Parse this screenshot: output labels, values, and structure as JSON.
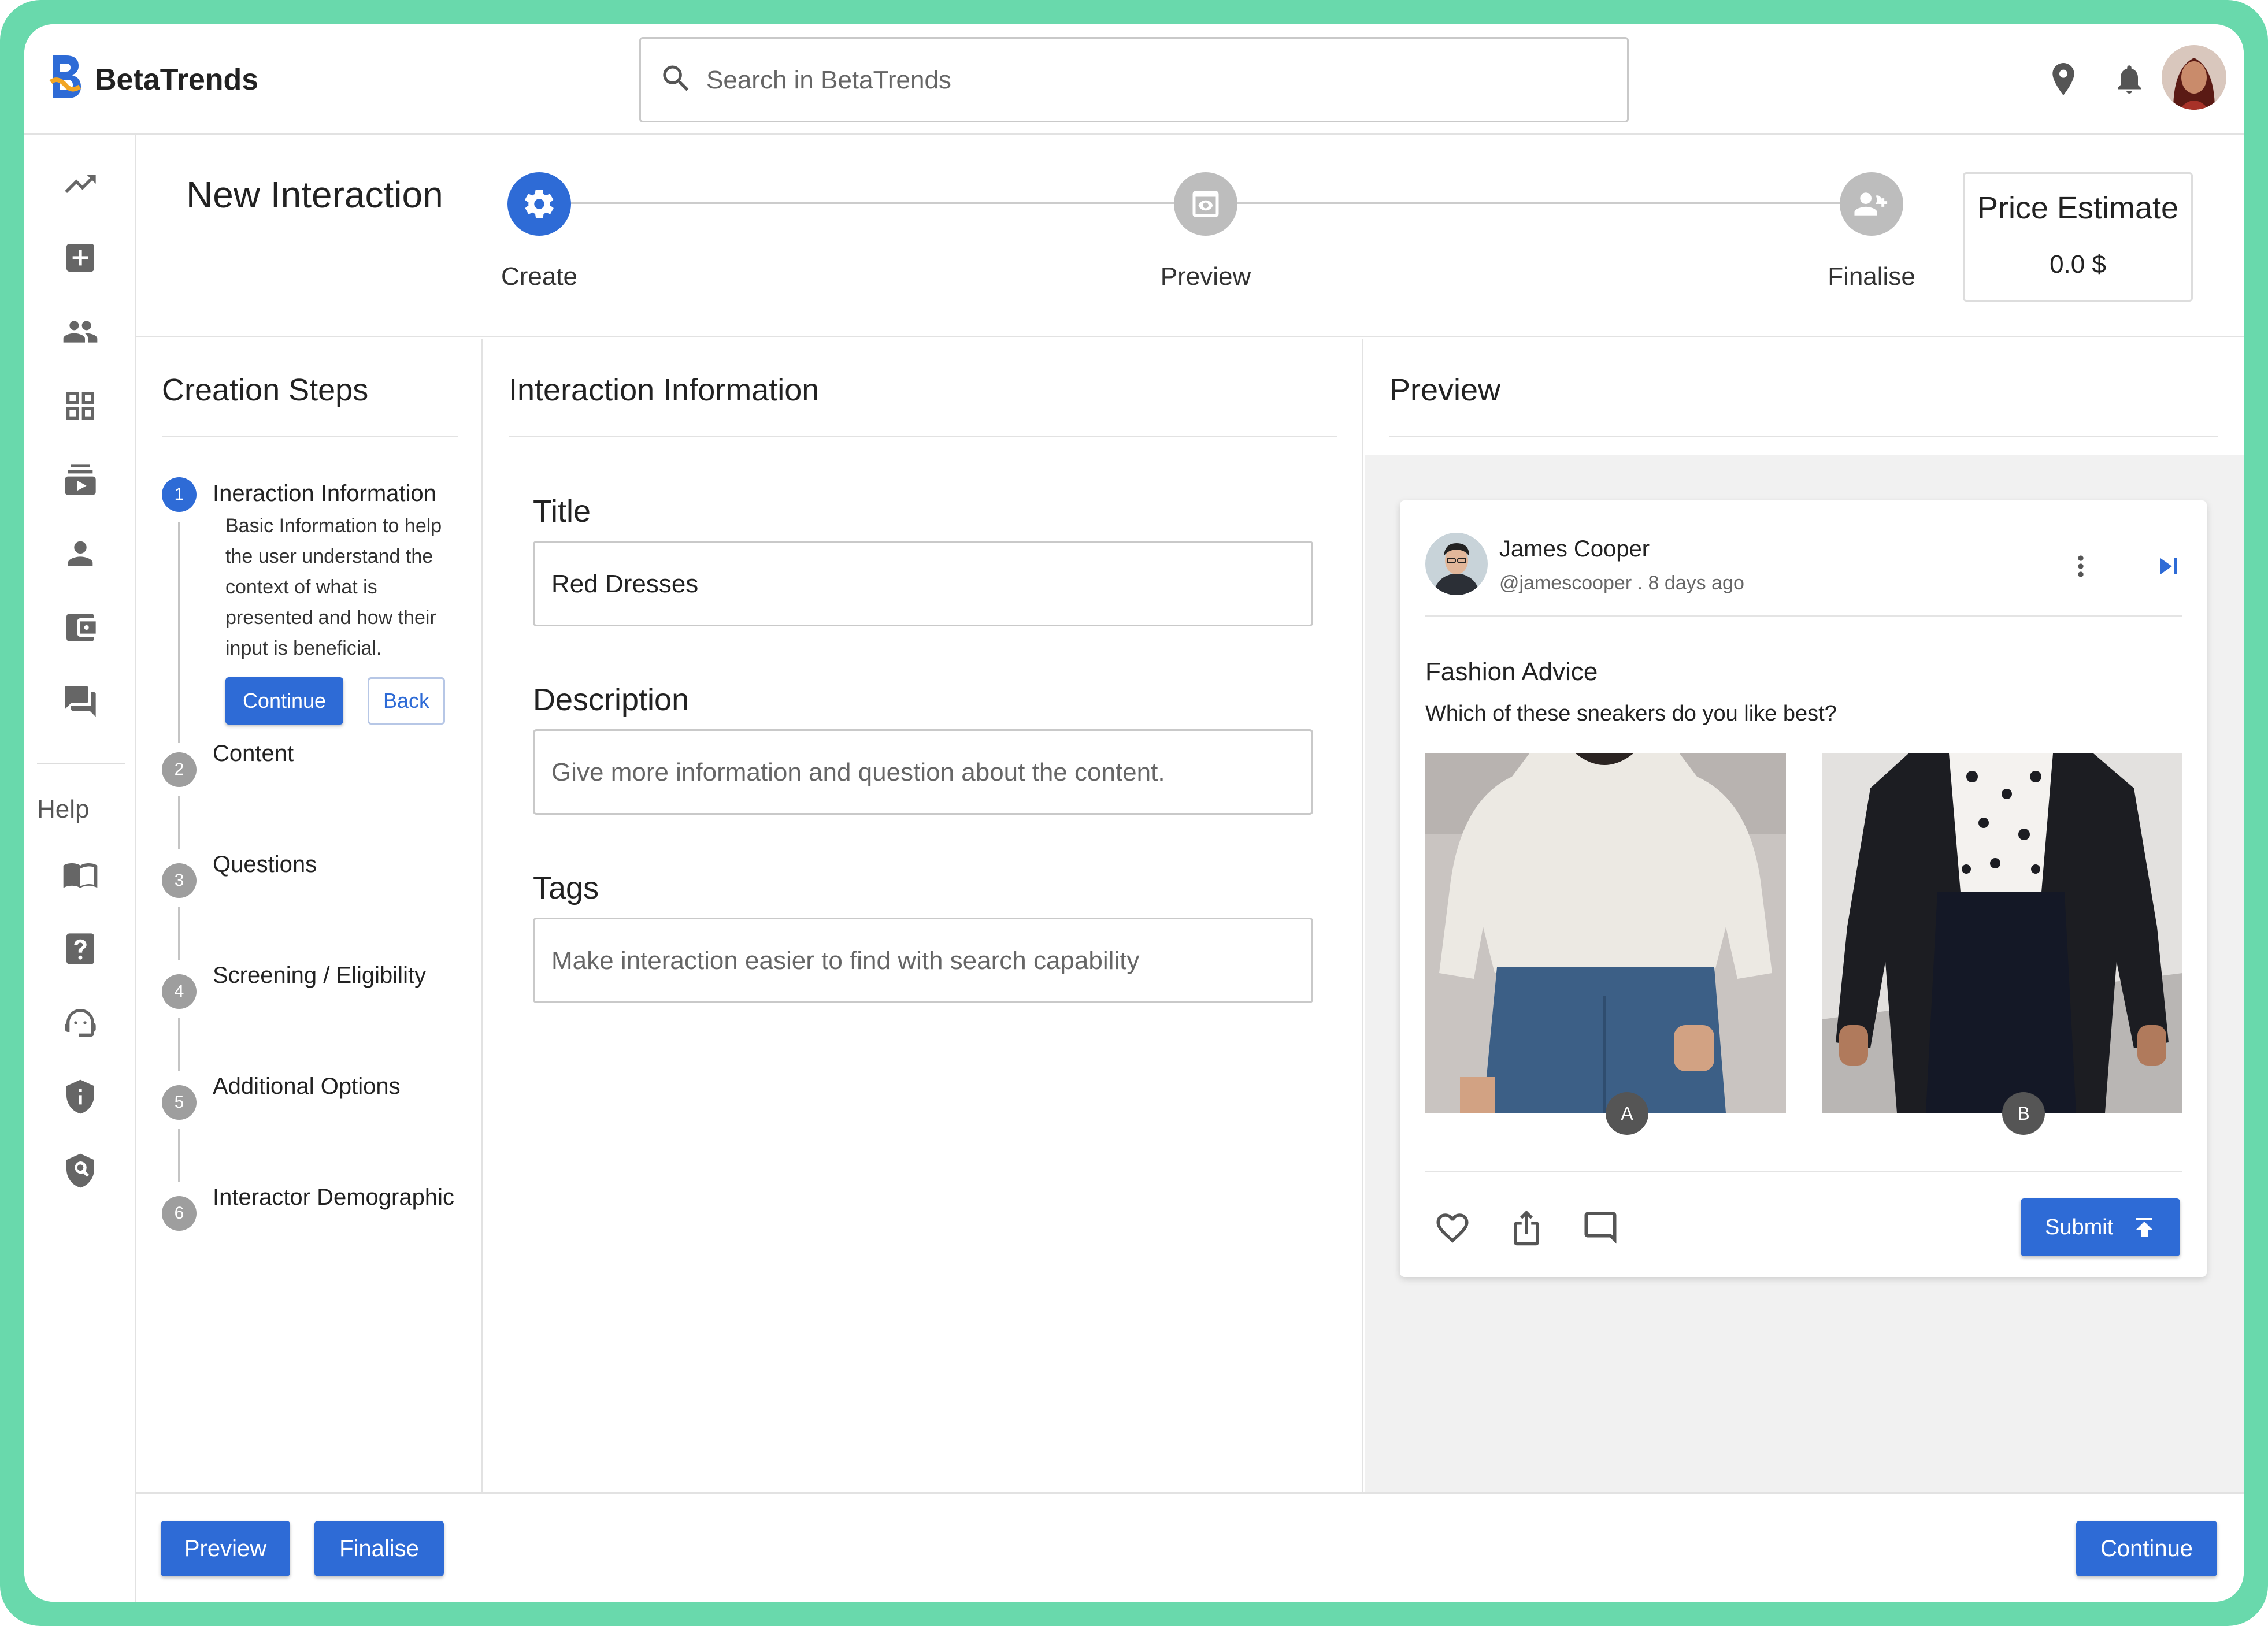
{
  "app": {
    "name": "BetaTrends"
  },
  "search": {
    "placeholder": "Search in BetaTrends"
  },
  "sidebar": {
    "help_label": "Help",
    "items": [
      {
        "icon": "trending-icon"
      },
      {
        "icon": "add-box-icon"
      },
      {
        "icon": "people-icon"
      },
      {
        "icon": "dashboard-icon"
      },
      {
        "icon": "subscriptions-icon"
      },
      {
        "icon": "person-icon"
      },
      {
        "icon": "wallet-icon"
      },
      {
        "icon": "forum-icon"
      }
    ],
    "help_items": [
      {
        "icon": "book-icon"
      },
      {
        "icon": "help-icon"
      },
      {
        "icon": "support-agent-icon"
      },
      {
        "icon": "privacy-shield-icon"
      },
      {
        "icon": "security-search-icon"
      }
    ]
  },
  "header": {
    "title": "New Interaction",
    "steps": [
      {
        "label": "Create",
        "state": "active"
      },
      {
        "label": "Preview",
        "state": "inactive"
      },
      {
        "label": "Finalise",
        "state": "inactive"
      }
    ],
    "price": {
      "title": "Price Estimate",
      "value": "0.0 $"
    }
  },
  "creation_steps": {
    "heading": "Creation Steps",
    "items": [
      {
        "num": "1",
        "label": "Ineraction Information",
        "description": "Basic Information to help the user understand the context of what is presented and how their input is beneficial.",
        "active": true
      },
      {
        "num": "2",
        "label": "Content"
      },
      {
        "num": "3",
        "label": "Questions"
      },
      {
        "num": "4",
        "label": "Screening / Eligibility"
      },
      {
        "num": "5",
        "label": "Additional Options"
      },
      {
        "num": "6",
        "label": "Interactor Demographic"
      }
    ],
    "continue_label": "Continue",
    "back_label": "Back"
  },
  "interaction_info": {
    "heading": "Interaction Information",
    "title_label": "Title",
    "title_value": "Red Dresses",
    "description_label": "Description",
    "description_placeholder": "Give more information and question about the content.",
    "tags_label": "Tags",
    "tags_placeholder": "Make interaction easier to find with search capability"
  },
  "preview": {
    "heading": "Preview",
    "post": {
      "author": "James Cooper",
      "handle": "@jamescooper . 8 days ago",
      "title": "Fashion Advice",
      "question": "Which of these sneakers do you like best?",
      "options": [
        "A",
        "B"
      ],
      "submit_label": "Submit"
    }
  },
  "footer": {
    "preview_label": "Preview",
    "finalise_label": "Finalise",
    "continue_label": "Continue"
  },
  "colors": {
    "accent": "#2e6bd6",
    "frame": "#69d9ac",
    "inactive": "#bdbdbd"
  }
}
